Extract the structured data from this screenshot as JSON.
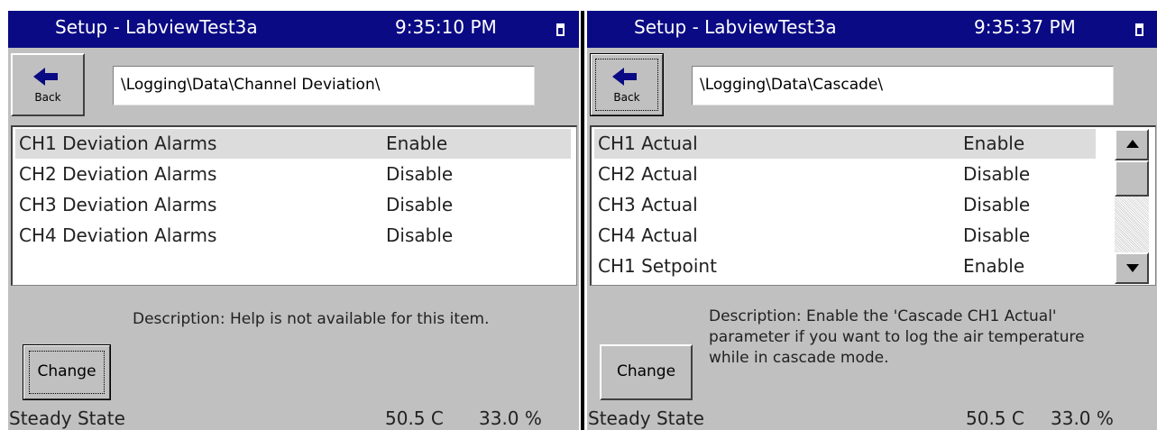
{
  "panels": [
    {
      "title": "Setup - LabviewTest3a",
      "time": "9:35:10 PM",
      "back_label": "Back",
      "path": "\\Logging\\Data\\Channel Deviation\\",
      "rows": [
        {
          "name": "CH1 Deviation Alarms",
          "value": "Enable"
        },
        {
          "name": "CH2 Deviation Alarms",
          "value": "Disable"
        },
        {
          "name": "CH3 Deviation Alarms",
          "value": "Disable"
        },
        {
          "name": "CH4 Deviation Alarms",
          "value": "Disable"
        }
      ],
      "description": "Description:  Help is not available for this item.",
      "change_label": "Change",
      "status": "Steady State",
      "temperature": "50.5 C",
      "percent": "33.0 %"
    },
    {
      "title": "Setup - LabviewTest3a",
      "time": "9:35:37 PM",
      "back_label": "Back",
      "path": "\\Logging\\Data\\Cascade\\",
      "rows": [
        {
          "name": "CH1 Actual",
          "value": "Enable"
        },
        {
          "name": "CH2 Actual",
          "value": "Disable"
        },
        {
          "name": "CH3 Actual",
          "value": "Disable"
        },
        {
          "name": "CH4 Actual",
          "value": "Disable"
        },
        {
          "name": "CH1 Setpoint",
          "value": "Enable"
        }
      ],
      "description_lines": [
        "Description:  Enable the 'Cascade CH1 Actual'",
        "parameter if you want to log the air temperature",
        "while in cascade mode."
      ],
      "change_label": "Change",
      "status": "Steady State",
      "temperature": "50.5 C",
      "percent": "33.0 %"
    }
  ],
  "colors": {
    "titlebar": "#0a0a84",
    "panel_bg": "#c0c0c0",
    "selection": "#dcdcdc"
  }
}
